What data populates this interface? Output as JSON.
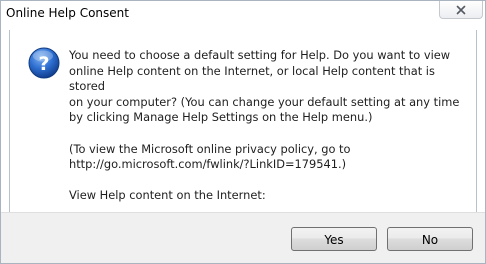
{
  "window": {
    "title": "Online Help Consent"
  },
  "icons": {
    "dialog_icon": "question-icon",
    "close": "close-icon"
  },
  "message": {
    "paragraph1": "You need to choose a default setting for Help.  Do you want to view\nonline Help content on the Internet, or local Help content that is stored\non your computer?  (You can change your default setting at any time\nby clicking Manage Help Settings on the Help menu.)",
    "paragraph2": "(To view the Microsoft online privacy policy, go to\nhttp://go.microsoft.com/fwlink/?LinkID=179541.)",
    "paragraph3": "View Help content on the Internet:"
  },
  "buttons": {
    "yes": "Yes",
    "no": "No"
  },
  "colors": {
    "icon_blue": "#1f5fbf",
    "footer_bg": "#f0f0f0"
  }
}
